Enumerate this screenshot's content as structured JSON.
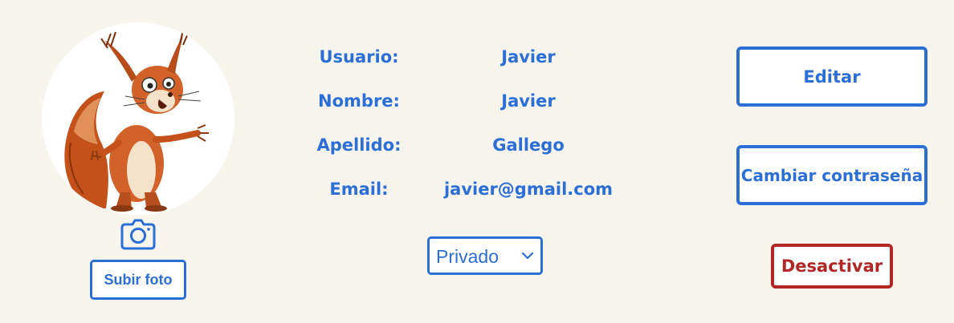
{
  "profile": {
    "avatar_alt": "squirrel-avatar",
    "upload_label": "Subir foto"
  },
  "info": {
    "rows": [
      {
        "label": "Usuario:",
        "value": "Javier"
      },
      {
        "label": "Nombre:",
        "value": "Javier"
      },
      {
        "label": "Apellido:",
        "value": "Gallego"
      },
      {
        "label": "Email:",
        "value": "javier@gmail.com"
      }
    ],
    "privacy": {
      "selected": "Privado"
    }
  },
  "actions": {
    "edit_label": "Editar",
    "change_password_label": "Cambiar contraseña",
    "deactivate_label": "Desactivar"
  },
  "colors": {
    "accent": "#2b6fd6",
    "danger": "#b22626",
    "background": "#f7f4ed"
  },
  "icons": {
    "camera": "camera-icon",
    "dropdown": "chevron-down-icon"
  }
}
